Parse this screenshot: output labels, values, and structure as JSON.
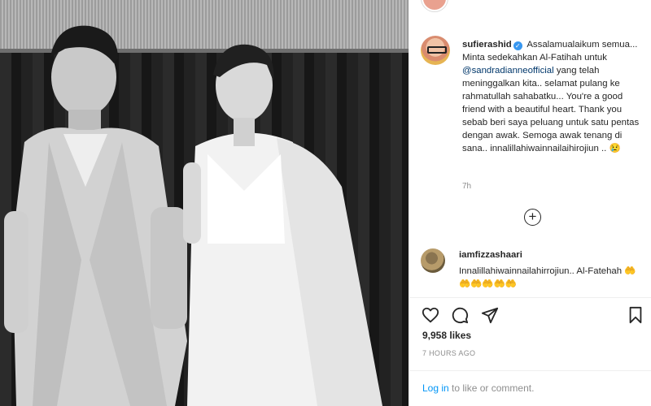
{
  "post": {
    "image_alt": "Black and white photo of a man in a light suit and a woman in a white gown posing in front of a dark curtain"
  },
  "author": {
    "username": "sufierashid",
    "avatar_icon": "profile-avatar",
    "verified_icon": "verified-badge-icon"
  },
  "caption": {
    "part1": "Assalamualaikum semua... Minta sedekahkan Al-Fatihah untuk ",
    "mention": "@sandradianneofficial",
    "part2": " yang telah meninggalkan kita.. selamat pulang ke rahmatullah sahabatku... You're a good friend with a beautiful heart. Thank you sebab beri saya peluang untuk satu pentas dengan awak. Semoga awak tenang di sana.. innalillahiwainnailaihirojiun .. 😢",
    "time_ago": "7h"
  },
  "load_more": {
    "label": "+"
  },
  "comments": [
    {
      "username": "iamfizzashaari",
      "text": "Innalillahiwainnailahirrojiun.. Al-Fatehah 🤲🤲🤲🤲🤲🤲"
    }
  ],
  "actions": {
    "like_icon": "heart-icon",
    "comment_icon": "comment-icon",
    "share_icon": "share-icon",
    "save_icon": "bookmark-icon"
  },
  "likes_text": "9,958 likes",
  "posted_ago": "7 HOURS AGO",
  "login": {
    "link_text": "Log in",
    "rest_text": " to like or comment."
  },
  "colors": {
    "link": "#0095f6",
    "mention": "#00376b",
    "verified": "#3897f0",
    "muted": "#8e8e8e"
  }
}
